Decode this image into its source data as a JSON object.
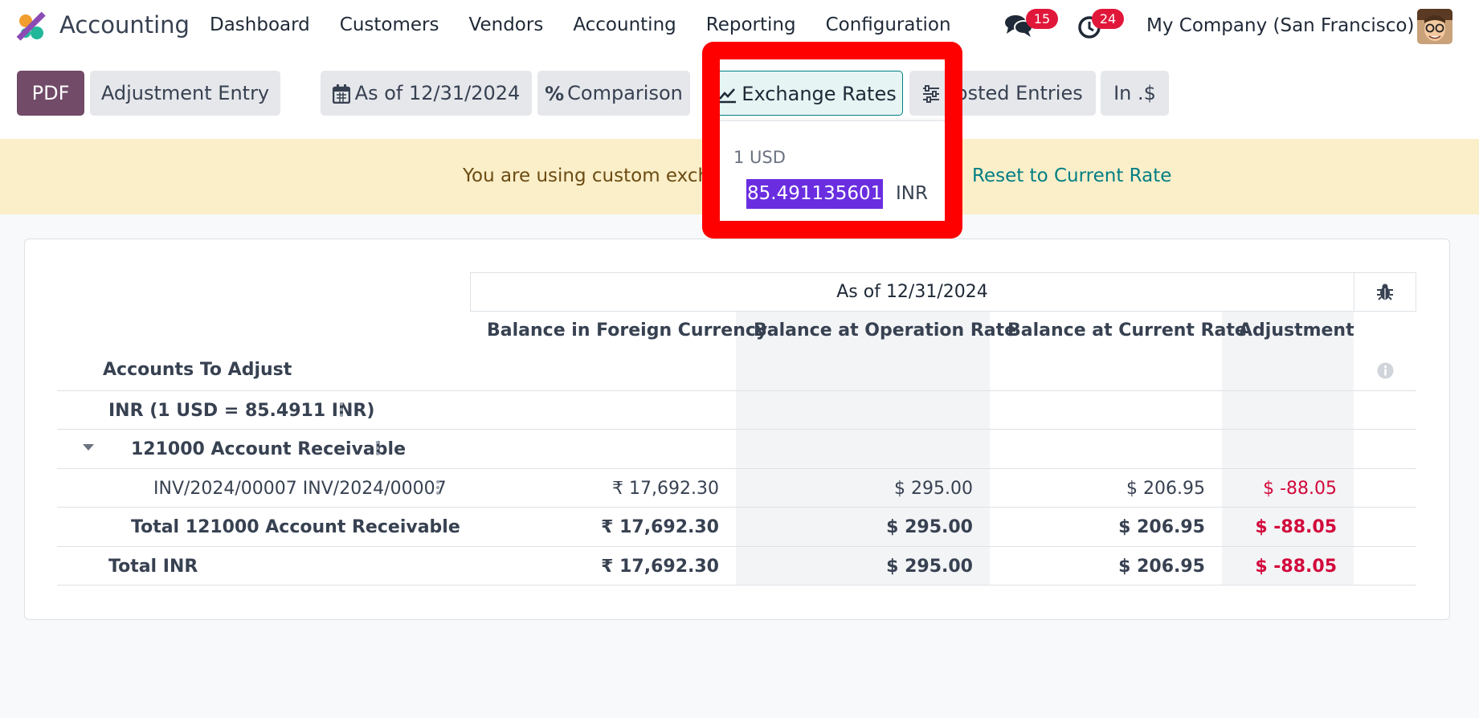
{
  "app": {
    "name": "Accounting"
  },
  "menu": [
    "Dashboard",
    "Customers",
    "Vendors",
    "Accounting",
    "Reporting",
    "Configuration"
  ],
  "nav": {
    "messages_count": "15",
    "activities_count": "24",
    "company": "My Company (San Francisco)"
  },
  "toolbar": {
    "pdf": "PDF",
    "adjustment_entry": "Adjustment Entry",
    "as_of": "As of 12/31/2024",
    "comparison": "Comparison",
    "exchange_rates": "Exchange Rates",
    "posted_entries": "Posted Entries",
    "in_currency": "In .$"
  },
  "banner": {
    "text": "You are using custom exchange rates.",
    "link": "Reset to Current Rate"
  },
  "popover": {
    "base": "1 USD",
    "rate_value": "85.4911356013",
    "target": "INR"
  },
  "report": {
    "period_header": "As of 12/31/2024",
    "columns": [
      "Balance in Foreign Currency",
      "Balance at Operation Rate",
      "Balance at Current Rate",
      "Adjustment"
    ],
    "accounts_header": "Accounts To Adjust",
    "rows": [
      {
        "label": "INR (1 USD = 85.4911 INR)",
        "values": [
          "",
          "",
          "",
          ""
        ]
      },
      {
        "label": "121000 Account Receivable",
        "values": [
          "",
          "",
          "",
          ""
        ]
      },
      {
        "label": "INV/2024/00007 INV/2024/00007",
        "values": [
          "₹ 17,692.30",
          "$ 295.00",
          "$ 206.95",
          "$ -88.05"
        ]
      },
      {
        "label": "Total 121000 Account Receivable",
        "values": [
          "₹ 17,692.30",
          "$ 295.00",
          "$ 206.95",
          "$ -88.05"
        ]
      },
      {
        "label": "Total INR",
        "values": [
          "₹ 17,692.30",
          "$ 295.00",
          "$ 206.95",
          "$ -88.05"
        ]
      }
    ]
  },
  "colors": {
    "brand": "#714b67",
    "accent": "#017e84",
    "negative": "#d2093b",
    "highlight_frame": "#ff0000",
    "selection": "#6a2ee0"
  },
  "icons": [
    "odoo-logo-icon",
    "chat-icon",
    "clock-icon",
    "calendar-icon",
    "percent-icon",
    "line-chart-icon",
    "sliders-icon",
    "bug-icon",
    "info-icon",
    "caret-down-icon",
    "kebab-icon"
  ]
}
